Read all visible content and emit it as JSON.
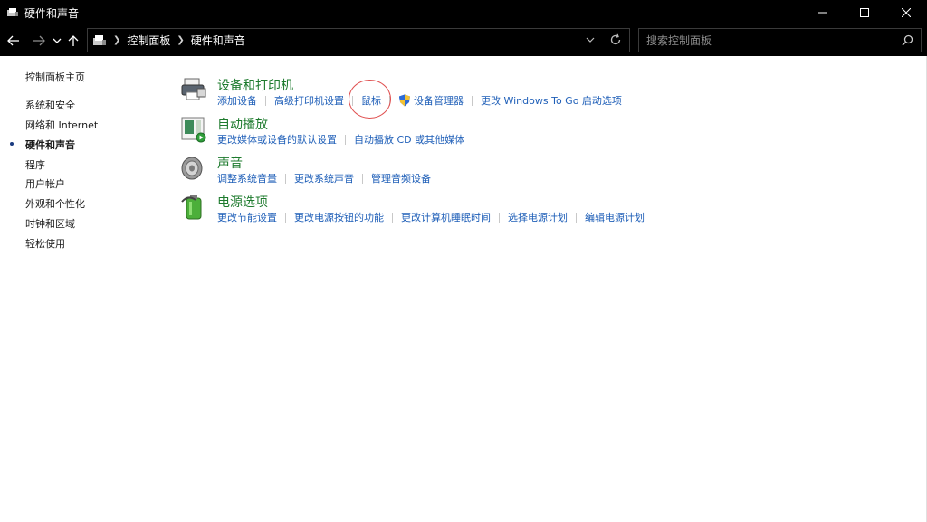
{
  "window": {
    "title": "硬件和声音"
  },
  "address": {
    "breadcrumbs": [
      "控制面板",
      "硬件和声音"
    ],
    "search_placeholder": "搜索控制面板"
  },
  "leftnav": {
    "items": [
      {
        "label": "控制面板主页",
        "active": false
      },
      {
        "label": "系统和安全",
        "active": false
      },
      {
        "label": "网络和 Internet",
        "active": false
      },
      {
        "label": "硬件和声音",
        "active": true
      },
      {
        "label": "程序",
        "active": false
      },
      {
        "label": "用户帐户",
        "active": false
      },
      {
        "label": "外观和个性化",
        "active": false
      },
      {
        "label": "时钟和区域",
        "active": false
      },
      {
        "label": "轻松使用",
        "active": false
      }
    ]
  },
  "categories": [
    {
      "title": "设备和打印机",
      "icon": "printer-icon",
      "links": [
        "添加设备",
        "高级打印机设置",
        "鼠标",
        "设备管理器",
        "更改 Windows To Go 启动选项"
      ]
    },
    {
      "title": "自动播放",
      "icon": "autoplay-icon",
      "links": [
        "更改媒体或设备的默认设置",
        "自动播放 CD 或其他媒体"
      ]
    },
    {
      "title": "声音",
      "icon": "speaker-icon",
      "links": [
        "调整系统音量",
        "更改系统声音",
        "管理音频设备"
      ]
    },
    {
      "title": "电源选项",
      "icon": "battery-icon",
      "links": [
        "更改节能设置",
        "更改电源按钮的功能",
        "更改计算机睡眠时间",
        "选择电源计划",
        "编辑电源计划"
      ]
    }
  ],
  "colors": {
    "link": "#1f5fb8",
    "category_title": "#1e7b2e",
    "titlebar": "#000000",
    "annotation_circle": "#e05050"
  }
}
